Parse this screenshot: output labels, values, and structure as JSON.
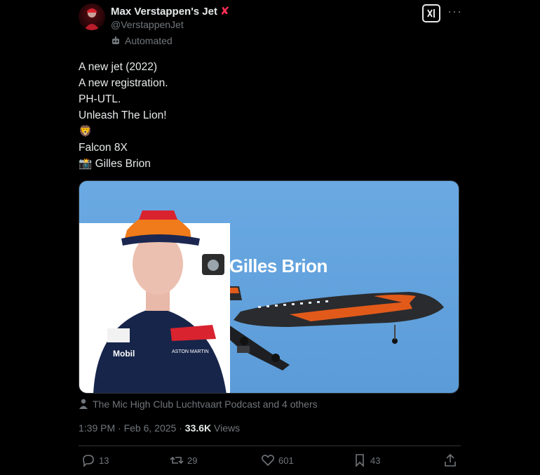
{
  "author": {
    "name": "Max Verstappen's Jet",
    "handle": "@VerstappenJet",
    "automated_label": "Automated",
    "badge": "✘"
  },
  "tweet": {
    "lines": [
      "A new jet (2022)",
      "A new registration.",
      "PH-UTL.",
      "Unleash The Lion!",
      "🦁",
      "Falcon 8X",
      "📸 Gilles Brion"
    ]
  },
  "media": {
    "overlay_text": "Gilles Brion",
    "overlay_icon": "📸",
    "sponsor_text": "Mobil",
    "sponsor2_text": "ASTON MARTIN",
    "colors": {
      "sky": "#5fa0dc",
      "jet_body": "#2a2b2e",
      "jet_accent": "#e25a1a",
      "cap": "#ef7b1a",
      "suit": "#17254a"
    }
  },
  "liked_by": "The Mic High Club Luchtvaart Podcast and 4 others",
  "meta": {
    "time": "1:39 PM",
    "date": "Feb 6, 2025",
    "views_count": "33.6K",
    "views_label": "Views"
  },
  "actions": {
    "replies": "13",
    "reposts": "29",
    "likes": "601",
    "bookmarks": "43"
  }
}
